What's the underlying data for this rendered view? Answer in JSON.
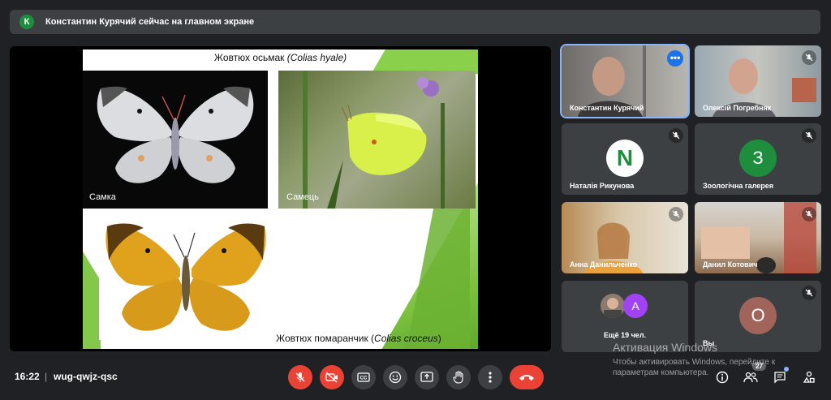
{
  "banner": {
    "avatar_letter": "К",
    "text": "Константин Курячий сейчас на главном экране"
  },
  "slide": {
    "title_plain": "Жовтюх осьмак ",
    "title_italic": "(Colias hyale)",
    "caption_female": "Самка",
    "caption_male": "Самець",
    "caption_bottom_plain": "Жовтюх помаранчик (",
    "caption_bottom_italic": "Colias croceus",
    "caption_bottom_end": ")"
  },
  "participants": [
    {
      "name": "Константин Курячий",
      "speaking": true
    },
    {
      "name": "Олексій Погребняк",
      "muted": true
    },
    {
      "name": "Наталія Рикунова",
      "avatar": "N",
      "muted": true
    },
    {
      "name": "Зоологічна галерея",
      "avatar": "З",
      "muted": true
    },
    {
      "name": "Анна Данильченко",
      "muted": true
    },
    {
      "name": "Данил Котович",
      "muted": true
    },
    {
      "name": "Ещё 19 чел.",
      "avatar": "А"
    },
    {
      "name": "Вы",
      "avatar": "О",
      "muted": true
    }
  ],
  "bottom": {
    "time": "16:22",
    "separator": "|",
    "meeting_code": "wug-qwjz-qsc",
    "people_count": "27"
  },
  "watermark": {
    "line1": "Активация Windows",
    "line2": "Чтобы активировать Windows, перейдите к параметрам компьютера."
  },
  "colors": {
    "bg": "#202124",
    "tile": "#3c4043",
    "danger": "#ea4335",
    "accent": "#1a73e8",
    "green_avatar": "#1e8e3e",
    "purple_avatar": "#a142f4",
    "brown_avatar": "#a1645a"
  }
}
